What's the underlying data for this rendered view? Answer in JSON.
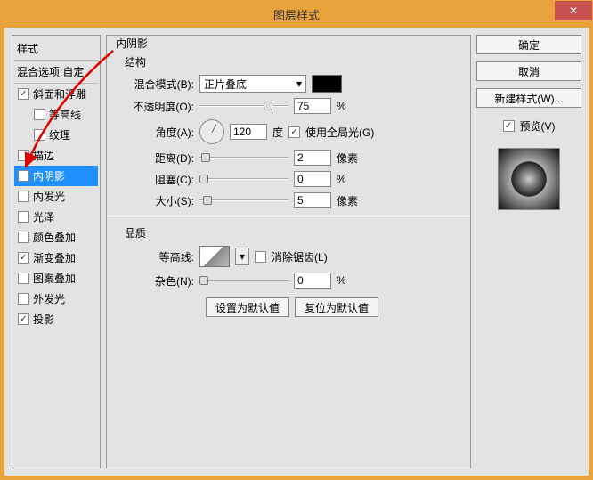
{
  "dialog": {
    "title": "图层样式",
    "close": "✕"
  },
  "styles": {
    "hdr": "样式",
    "mix": "混合选项:自定",
    "items": [
      {
        "label": "斜面和浮雕",
        "checked": true
      },
      {
        "label": "等高线",
        "checked": false,
        "sub": true
      },
      {
        "label": "纹理",
        "checked": false,
        "sub": true
      },
      {
        "label": "描边",
        "checked": false
      },
      {
        "label": "内阴影",
        "checked": true,
        "selected": true
      },
      {
        "label": "内发光",
        "checked": false
      },
      {
        "label": "光泽",
        "checked": false
      },
      {
        "label": "颜色叠加",
        "checked": false
      },
      {
        "label": "渐变叠加",
        "checked": true
      },
      {
        "label": "图案叠加",
        "checked": false
      },
      {
        "label": "外发光",
        "checked": false
      },
      {
        "label": "投影",
        "checked": true
      }
    ]
  },
  "inner_shadow": {
    "title": "内阴影",
    "structure_title": "结构",
    "blend_mode_label": "混合模式(B):",
    "blend_mode_value": "正片叠底",
    "opacity_label": "不透明度(O):",
    "opacity_value": "75",
    "opacity_unit": "%",
    "angle_label": "角度(A):",
    "angle_value": "120",
    "angle_unit": "度",
    "use_global_label": "使用全局光(G)",
    "distance_label": "距离(D):",
    "distance_value": "2",
    "distance_unit": "像素",
    "choke_label": "阻塞(C):",
    "choke_value": "0",
    "choke_unit": "%",
    "size_label": "大小(S):",
    "size_value": "5",
    "size_unit": "像素",
    "quality_title": "品质",
    "contour_label": "等高线:",
    "antialias_label": "消除锯齿(L)",
    "noise_label": "杂色(N):",
    "noise_value": "0",
    "noise_unit": "%",
    "make_default": "设置为默认值",
    "reset_default": "复位为默认值"
  },
  "right": {
    "ok": "确定",
    "cancel": "取消",
    "new_style": "新建样式(W)...",
    "preview": "预览(V)"
  },
  "chart_data": null
}
